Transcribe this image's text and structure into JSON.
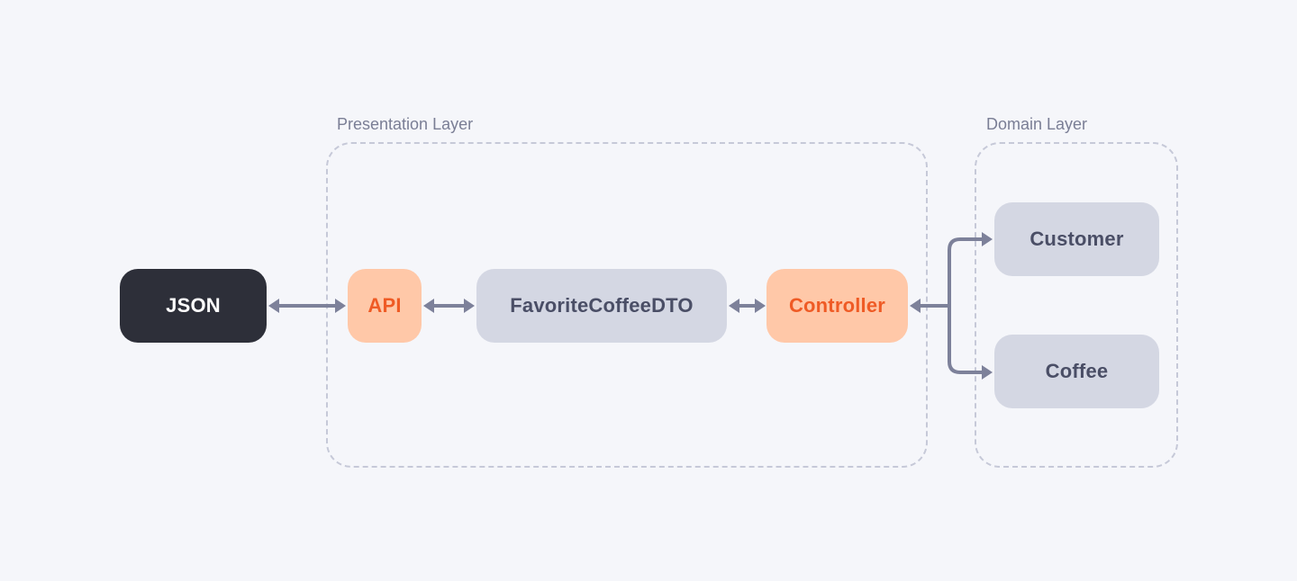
{
  "layers": {
    "presentation": {
      "label": "Presentation Layer"
    },
    "domain": {
      "label": "Domain Layer"
    }
  },
  "nodes": {
    "json": {
      "label": "JSON"
    },
    "api": {
      "label": "API"
    },
    "dto": {
      "label": "FavoriteCoffeeDTO"
    },
    "controller": {
      "label": "Controller"
    },
    "customer": {
      "label": "Customer"
    },
    "coffee": {
      "label": "Coffee"
    }
  },
  "colors": {
    "background": "#f5f6fa",
    "dashedBorder": "#c6c9d8",
    "arrow": "#7d819a",
    "nodeDark": "#2d2f39",
    "nodeOrangeBg": "#ffc8a8",
    "nodeOrangeText": "#ef5b25",
    "nodeGrayBg": "#d4d7e3",
    "nodeGrayText": "#4a4e66",
    "labelText": "#7a7e95"
  }
}
